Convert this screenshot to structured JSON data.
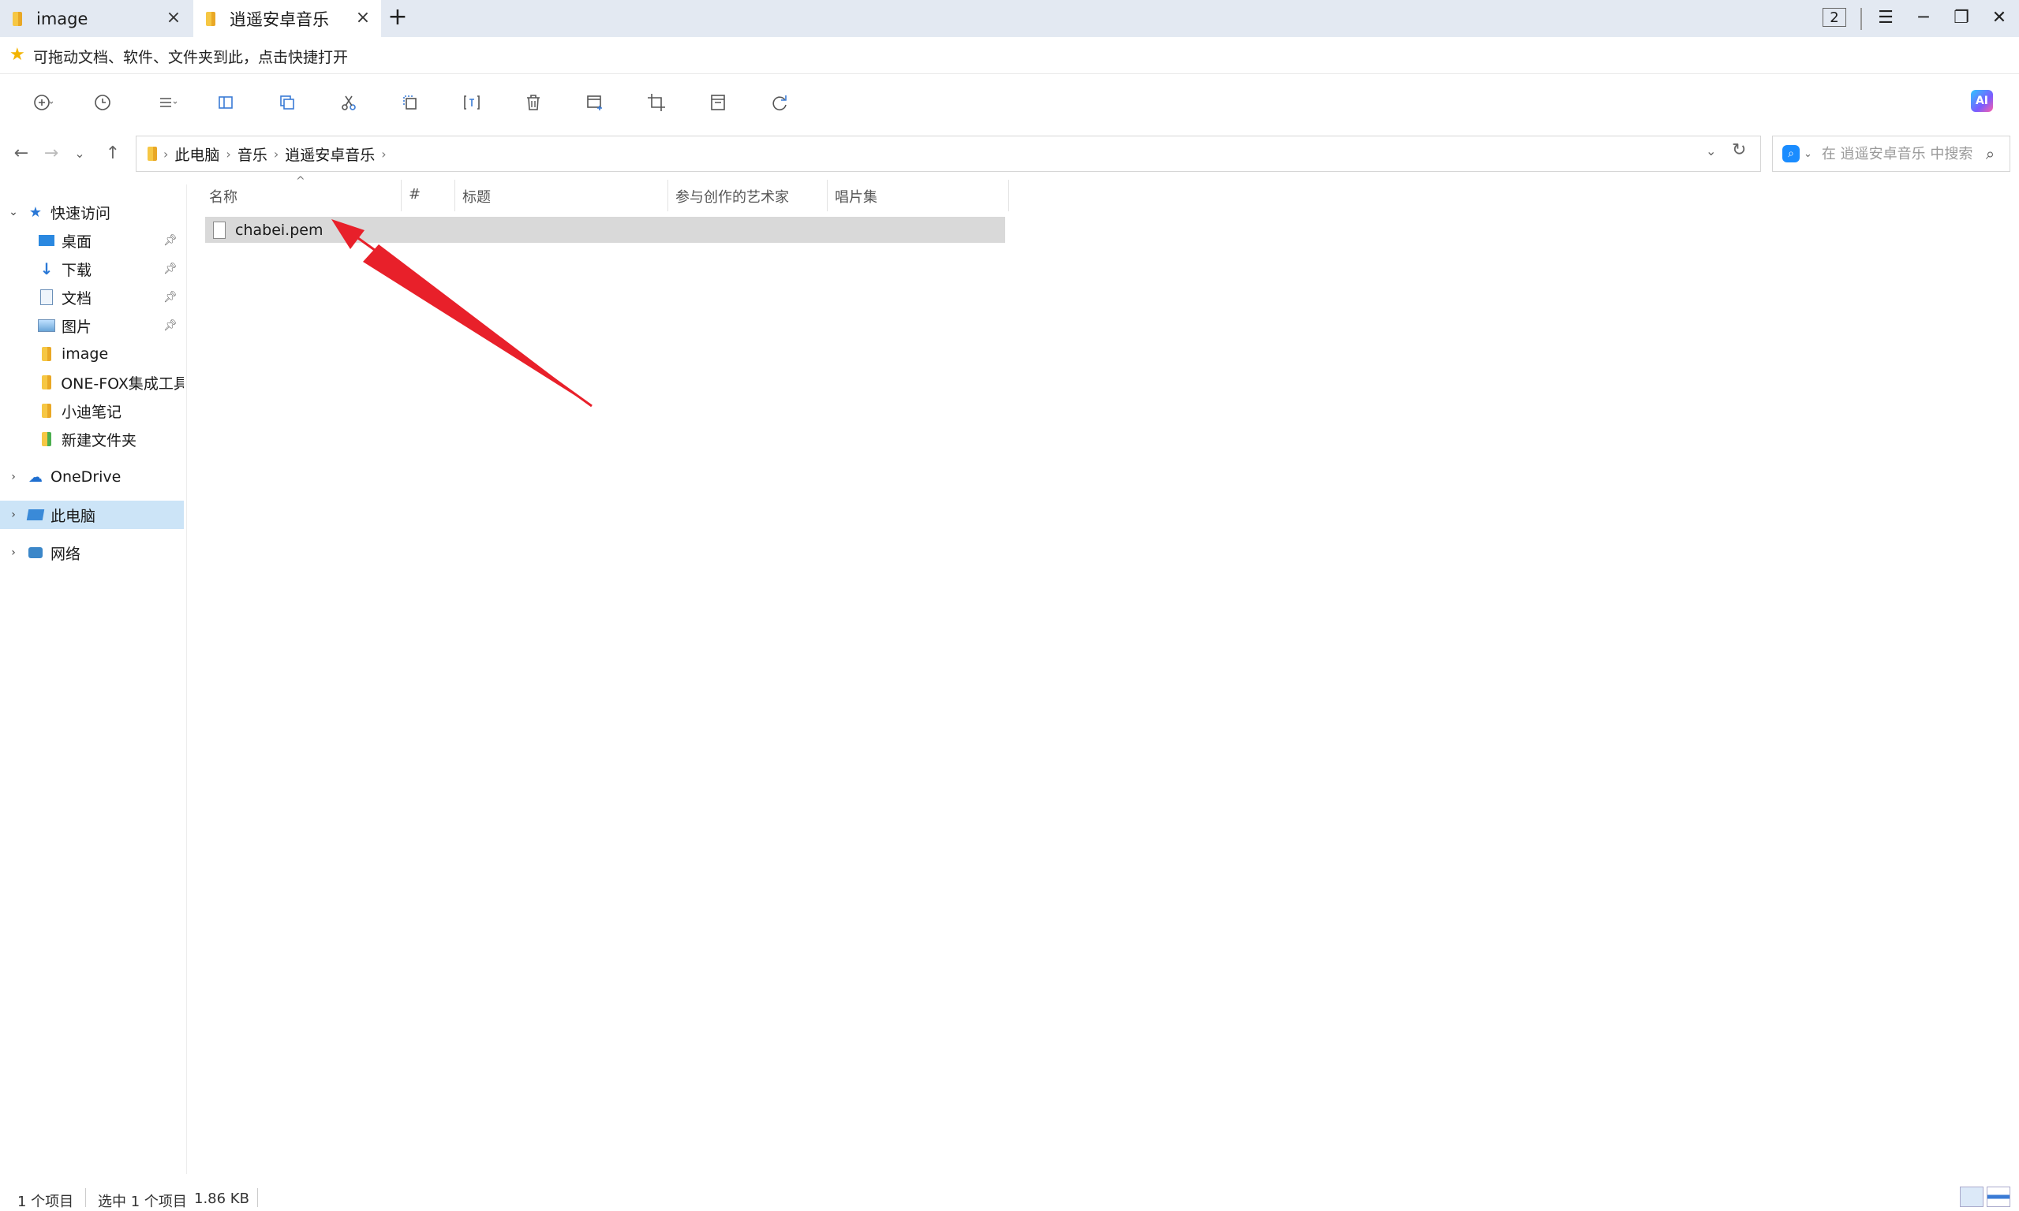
{
  "tabs": [
    {
      "label": "image",
      "active": false
    },
    {
      "label": "逍遥安卓音乐",
      "active": true
    }
  ],
  "window": {
    "tab_count": "2"
  },
  "favorites_bar": {
    "text": "可拖动文档、软件、文件夹到此，点击快捷打开"
  },
  "toolbar": {
    "ai_label": "AI"
  },
  "address": {
    "breadcrumbs": [
      "此电脑",
      "音乐",
      "逍遥安卓音乐"
    ]
  },
  "search": {
    "placeholder": "在 逍遥安卓音乐 中搜索"
  },
  "sidebar": {
    "quick_access": "快速访问",
    "items": [
      {
        "label": "桌面",
        "pinned": true
      },
      {
        "label": "下载",
        "pinned": true
      },
      {
        "label": "文档",
        "pinned": true
      },
      {
        "label": "图片",
        "pinned": true
      },
      {
        "label": "image",
        "pinned": false
      },
      {
        "label": "ONE-FOX集成工具",
        "pinned": false
      },
      {
        "label": "小迪笔记",
        "pinned": false
      },
      {
        "label": "新建文件夹",
        "pinned": false
      }
    ],
    "onedrive": "OneDrive",
    "this_pc": "此电脑",
    "network": "网络"
  },
  "columns": [
    "名称",
    "#",
    "标题",
    "参与创作的艺术家",
    "唱片集"
  ],
  "files": [
    {
      "name": "chabei.pem"
    }
  ],
  "status": {
    "count": "1 个项目",
    "selected": "选中 1 个项目",
    "size": "1.86 KB"
  },
  "colors": {
    "accent": "#1a8cff",
    "selection": "#cce4f7",
    "arrow": "#e8202a"
  }
}
